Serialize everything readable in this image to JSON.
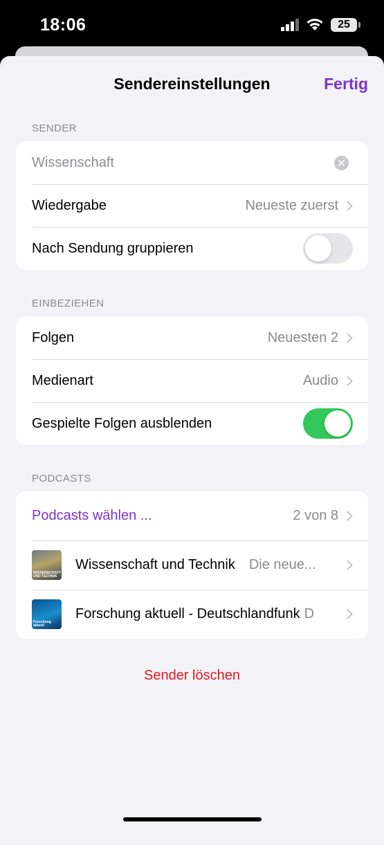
{
  "status_bar": {
    "time": "18:06",
    "battery": "25"
  },
  "nav": {
    "title": "Sendereinstellungen",
    "done_label": "Fertig"
  },
  "sections": {
    "sender": {
      "header": "SENDER",
      "name_value": "Wissenschaft",
      "playback_label": "Wiedergabe",
      "playback_value": "Neueste zuerst",
      "group_label": "Nach Sendung gruppieren",
      "group_toggle": false
    },
    "include": {
      "header": "EINBEZIEHEN",
      "episodes_label": "Folgen",
      "episodes_value": "Neuesten 2",
      "media_label": "Medienart",
      "media_value": "Audio",
      "hide_played_label": "Gespielte Folgen ausblenden",
      "hide_played_toggle": true
    },
    "podcasts": {
      "header": "PODCASTS",
      "choose_label": "Podcasts wählen ...",
      "choose_value": "2 von 8",
      "items": [
        {
          "title": "Wissenschaft und Technik",
          "subtitle": "Die neue...",
          "thumb_text": "WISSENSCHAFT UND TECHNIK"
        },
        {
          "title": "Forschung aktuell - Deutschlandfunk",
          "subtitle": "D",
          "thumb_text": "Forschung aktuell"
        }
      ]
    }
  },
  "delete_label": "Sender löschen",
  "colors": {
    "accent": "#7b34c9",
    "destructive": "#e0191e",
    "toggle_on": "#34c759",
    "background": "#f2f2f7"
  }
}
